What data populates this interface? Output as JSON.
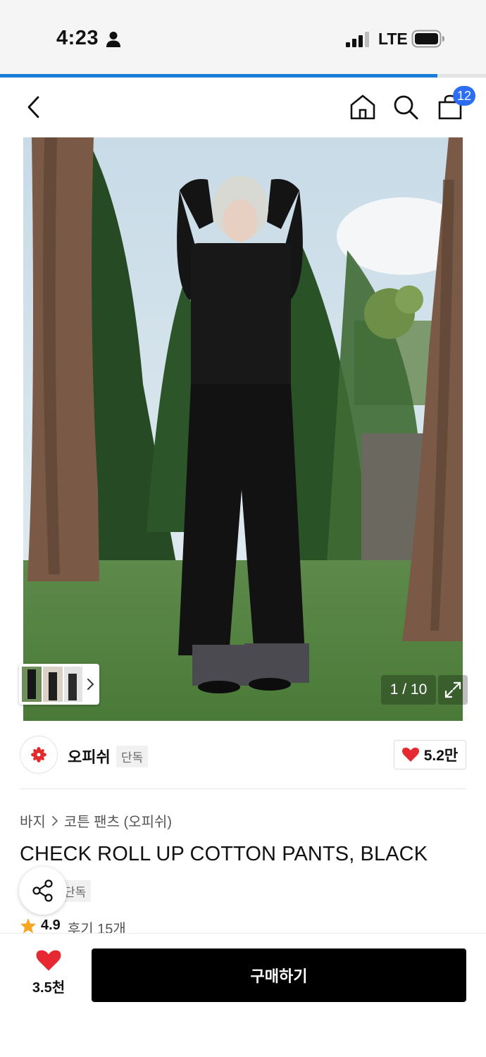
{
  "status_bar": {
    "time": "4:23",
    "network": "LTE"
  },
  "page_progress": 0.9,
  "nav": {
    "cart_count": "12"
  },
  "gallery": {
    "counter": "1 / 10"
  },
  "brand": {
    "name": "오피쉬",
    "tag": "단독",
    "likes": "5.2만"
  },
  "breadcrumb": {
    "category": "바지",
    "subcategory": "코튼 팬츠 (오피쉬)"
  },
  "product": {
    "title": "CHECK ROLL UP COTTON PANTS, BLACK",
    "tag": "단독"
  },
  "rating": {
    "score": "4.9",
    "reviews": "후기 15개"
  },
  "bottom": {
    "wish_count": "3.5천",
    "buy_label": "구매하기"
  },
  "colors": {
    "accent_blue": "#2b6ef5",
    "like_red": "#e62833",
    "star": "#f5a623",
    "buy_button": "#000000"
  },
  "icons": [
    "person-icon",
    "signal-icon",
    "battery-icon",
    "back-icon",
    "home-icon",
    "search-icon",
    "bag-icon",
    "chevron-right-icon",
    "expand-icon",
    "brand-logo",
    "heart-icon",
    "share-icon",
    "star-icon"
  ]
}
